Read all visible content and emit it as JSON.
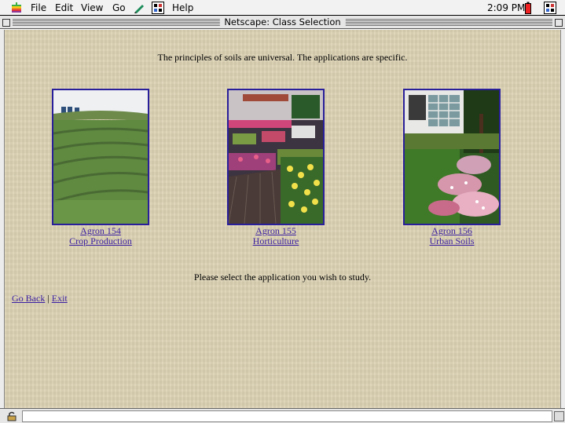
{
  "menubar": {
    "items": [
      "File",
      "Edit",
      "View",
      "Go",
      "Help"
    ],
    "clock": "2:09 PM"
  },
  "window": {
    "title": "Netscape: Class Selection"
  },
  "page": {
    "tagline": "The principles of soils are universal. The applications are specific.",
    "classes": [
      {
        "course": "Agron 154",
        "name": "Crop Production"
      },
      {
        "course": "Agron 155",
        "name": "Horticulture"
      },
      {
        "course": "Agron 156",
        "name": "Urban Soils"
      }
    ],
    "prompt": "Please select the application you wish to study.",
    "nav": {
      "back": "Go Back",
      "separator": "|",
      "exit": "Exit"
    }
  },
  "colors": {
    "background": "#dcd2b4",
    "link": "#3a1ea0",
    "frame": "#2a1f9a"
  }
}
